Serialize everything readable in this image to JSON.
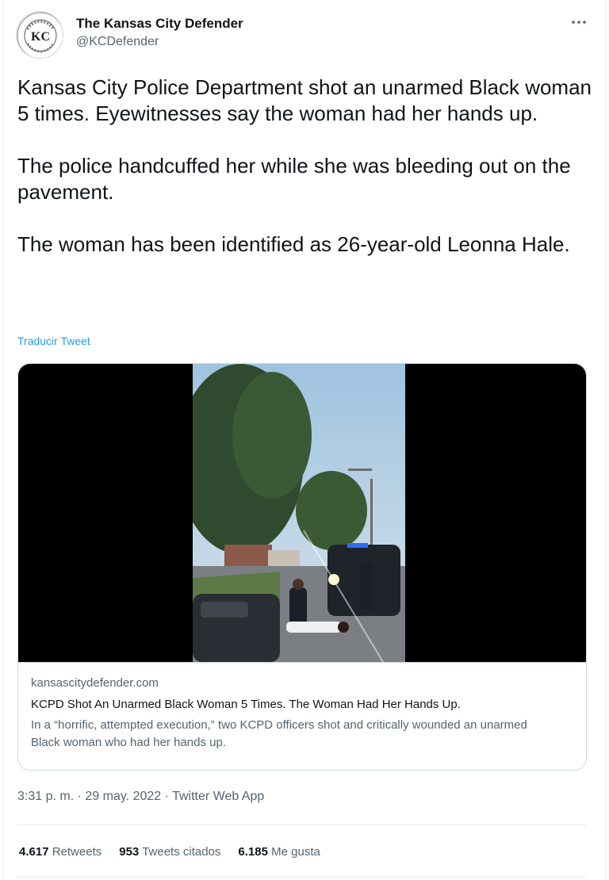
{
  "author": {
    "display_name": "The Kansas City Defender",
    "handle": "@KCDefender",
    "avatar_initials": "KC"
  },
  "tweet": {
    "text": "Kansas City Police Department shot an unarmed Black woman 5 times. Eyewitnesses say the woman had her hands up.\n\nThe police handcuffed her while she was bleeding out on the pavement.\n\nThe woman has been identified as 26-year-old Leonna Hale.",
    "translate_label": "Traducir Tweet"
  },
  "card": {
    "domain": "kansascitydefender.com",
    "title": "KCPD Shot An Unarmed Black Woman 5 Times. The Woman Had Her Hands Up.",
    "description": "In a “horrific, attempted execution,” two KCPD officers shot and critically wounded an unarmed Black woman who had her hands up."
  },
  "meta": {
    "timestamp": "3:31 p. m. · 29 may. 2022 · Twitter Web App"
  },
  "stats": {
    "retweets_count": "4.617",
    "retweets_label": "Retweets",
    "quotes_count": "953",
    "quotes_label": "Tweets citados",
    "likes_count": "6.185",
    "likes_label": "Me gusta"
  },
  "icons": {
    "more": "more-options-icon"
  },
  "colors": {
    "link": "#1d9bf0",
    "secondary_text": "#536471",
    "primary_text": "#0f1419",
    "border": "#cfd9de"
  }
}
